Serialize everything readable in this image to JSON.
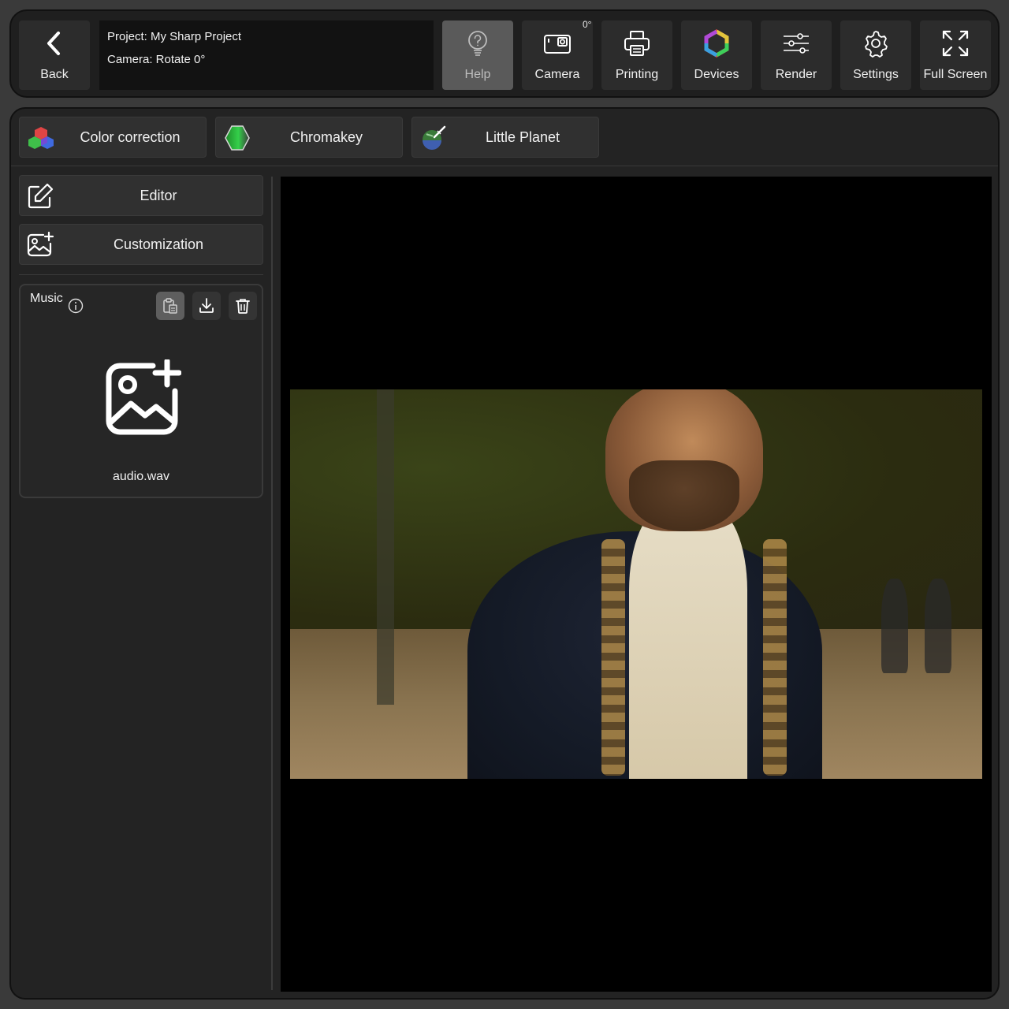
{
  "header": {
    "back_label": "Back",
    "project_line": "Project: My Sharp Project",
    "camera_line": "Camera: Rotate 0°",
    "camera_badge": "0°",
    "buttons": {
      "help": "Help",
      "camera": "Camera",
      "printing": "Printing",
      "devices": "Devices",
      "render": "Render",
      "settings": "Settings",
      "fullscreen": "Full Screen"
    }
  },
  "effects": {
    "color_correction": "Color correction",
    "chromakey": "Chromakey",
    "little_planet": "Little Planet"
  },
  "sidebar": {
    "editor": "Editor",
    "customization": "Customization",
    "music": {
      "title": "Music",
      "file_name": "audio.wav"
    }
  },
  "icons": {
    "back": "chevron-left-icon",
    "help": "lightbulb-question-icon",
    "camera": "action-camera-icon",
    "printing": "printer-icon",
    "devices": "hexagon-color-ring-icon",
    "render": "sliders-icon",
    "settings": "gear-icon",
    "fullscreen": "expand-arrows-icon"
  },
  "colors": {
    "background": "#3a3a3a",
    "panel": "#232323",
    "button": "#303030",
    "help_active": "#5a5a5a",
    "preview": "#000000"
  }
}
